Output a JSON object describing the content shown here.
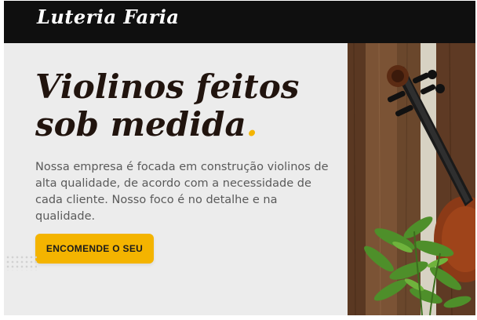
{
  "header": {
    "logo": "Luteria Faria"
  },
  "hero": {
    "title_main": "Violinos feitos sob medida",
    "title_punct": ".",
    "description": "Nossa empresa é focada em construção violinos de alta qualidade, de acordo com a necessidade de cada cliente. Nosso foco é no detalhe e na qualidade.",
    "cta_label": "ENCOMENDE O SEU"
  },
  "image": {
    "semantic": "violin-with-plant-photo"
  },
  "colors": {
    "accent": "#f4b400",
    "header_bg": "#0f0f0f",
    "title": "#21140e",
    "text": "#5a5a5a",
    "page_bg": "#ececec"
  }
}
